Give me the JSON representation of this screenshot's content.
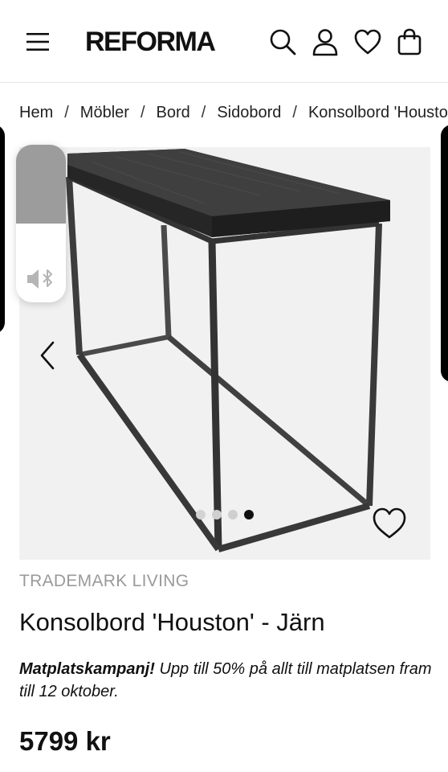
{
  "header": {
    "logo": "REFORMA",
    "icons": [
      "menu-icon",
      "search-icon",
      "user-icon",
      "heart-icon",
      "shopping-bag-icon"
    ]
  },
  "breadcrumb": {
    "items": [
      "Hem",
      "Möbler",
      "Bord",
      "Sidobord",
      "Konsolbord 'Houston'"
    ],
    "separator": "/"
  },
  "gallery": {
    "dot_count": 4,
    "active_dot_index": 3,
    "prev_icon": "chevron-left-icon",
    "favorite_icon": "heart-outline-icon"
  },
  "volume_overlay": {
    "level": 0.5,
    "icon": "speaker-bluetooth-icon"
  },
  "product": {
    "brand": "TRADEMARK LIVING",
    "title": "Konsolbord 'Houston' - Järn",
    "promo_bold": "Matplatskampanj!",
    "promo_text": " Upp till 50% på allt till matplatsen fram till 12 oktober.",
    "price": "5799 kr"
  },
  "colors": {
    "text": "#111111",
    "muted": "#9a9a9a",
    "image_bg": "#f1f1f1",
    "dot_active": "#111111",
    "dot_inactive": "#cfcfcf"
  }
}
